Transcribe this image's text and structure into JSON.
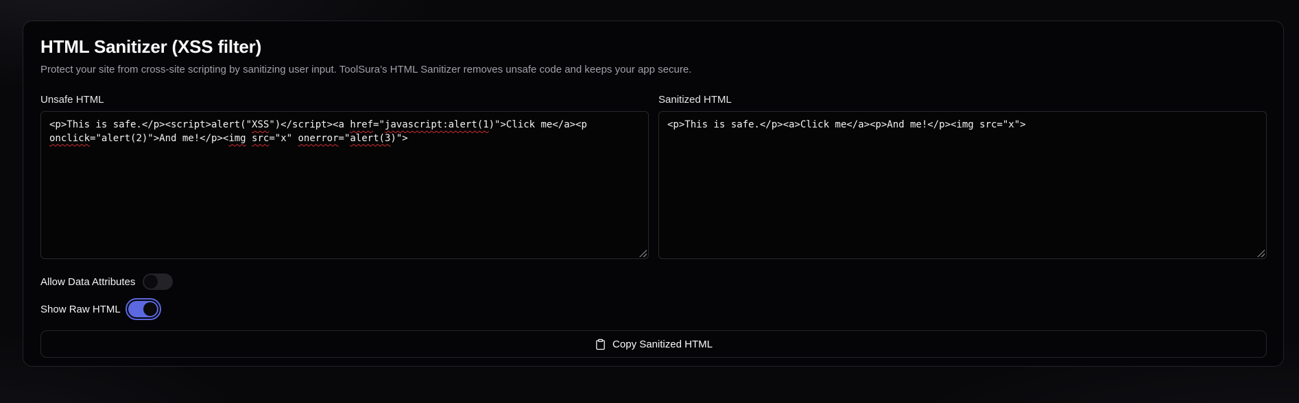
{
  "header": {
    "title": "HTML Sanitizer (XSS filter)",
    "subtitle": "Protect your site from cross-site scripting by sanitizing user input. ToolSura’s HTML Sanitizer removes unsafe code and keeps your app secure."
  },
  "editors": {
    "unsafe": {
      "label": "Unsafe HTML",
      "segments": [
        {
          "t": "<p>This is safe.</p><script>alert(\"",
          "sq": false
        },
        {
          "t": "XSS",
          "sq": true
        },
        {
          "t": "\")</script><a ",
          "sq": false
        },
        {
          "t": "href",
          "sq": true
        },
        {
          "t": "=\"",
          "sq": false
        },
        {
          "t": "javascript:alert(1",
          "sq": true
        },
        {
          "t": ")\">Click me</a><p ",
          "sq": false
        },
        {
          "t": "onclick",
          "sq": true
        },
        {
          "t": "=\"alert(2)\">And me!</p><",
          "sq": false
        },
        {
          "t": "img",
          "sq": true
        },
        {
          "t": " ",
          "sq": false
        },
        {
          "t": "src",
          "sq": true
        },
        {
          "t": "=\"x\" ",
          "sq": false
        },
        {
          "t": "onerror",
          "sq": true
        },
        {
          "t": "=\"",
          "sq": false
        },
        {
          "t": "alert(3",
          "sq": true
        },
        {
          "t": ")\">",
          "sq": false
        }
      ]
    },
    "sanitized": {
      "label": "Sanitized HTML",
      "value": "<p>This is safe.</p><a>Click me</a><p>And me!</p><img src=\"x\">"
    }
  },
  "toggles": [
    {
      "label": "Allow Data Attributes",
      "state": "off"
    },
    {
      "label": "Show Raw HTML",
      "state": "on"
    }
  ],
  "copy_button": {
    "label": "Copy Sanitized HTML",
    "icon": "clipboard-icon"
  },
  "colors": {
    "accent": "#5b68df",
    "card_border": "#232329",
    "squiggle": "#cf2e2e",
    "subtitle_text": "#a1a1aa"
  }
}
